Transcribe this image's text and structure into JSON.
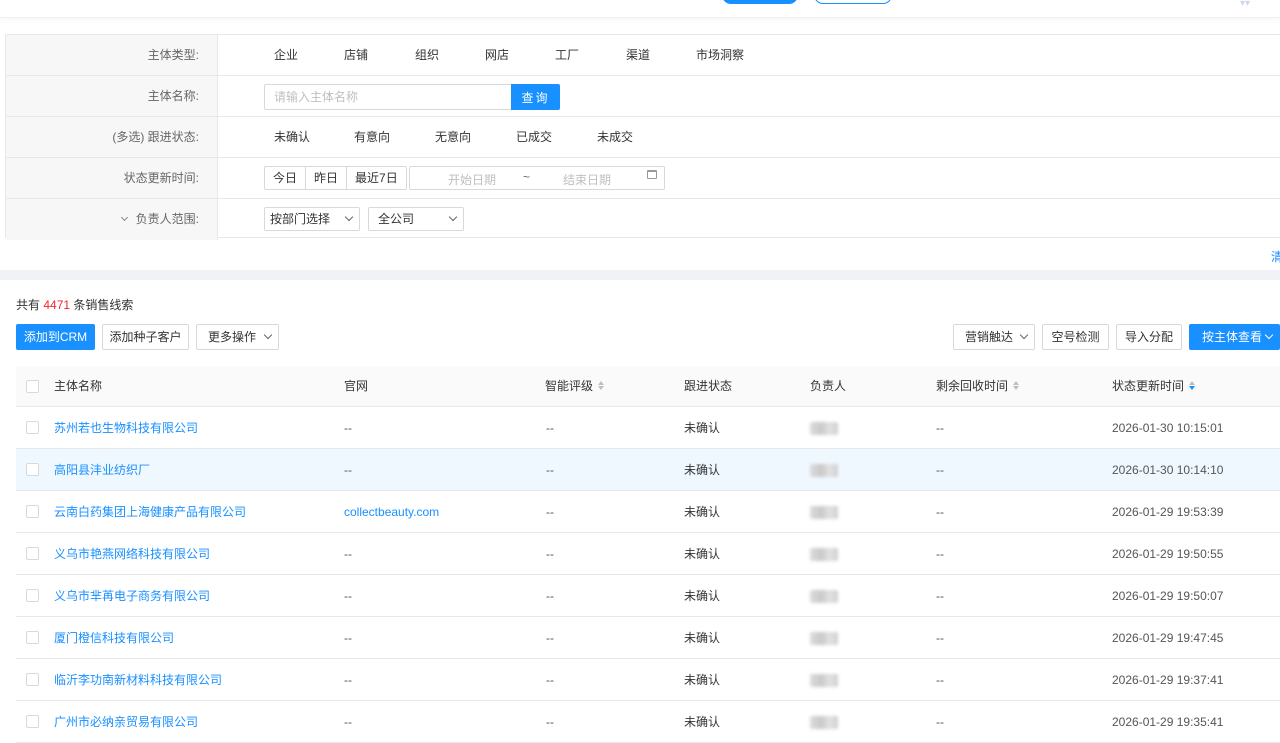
{
  "filters": {
    "subject_type": {
      "label": "主体类型:",
      "options": [
        "企业",
        "店铺",
        "组织",
        "网店",
        "工厂",
        "渠道",
        "市场洞察"
      ]
    },
    "subject_name": {
      "label": "主体名称:",
      "placeholder": "请输入主体名称",
      "button": "查询"
    },
    "follow_status": {
      "label": "(多选) 跟进状态:",
      "options": [
        "未确认",
        "有意向",
        "无意向",
        "已成交",
        "未成交"
      ]
    },
    "update_time": {
      "label": "状态更新时间:",
      "quick": [
        "今日",
        "昨日",
        "最近7日"
      ],
      "start_placeholder": "开始日期",
      "separator": "~",
      "end_placeholder": "结束日期"
    },
    "owner_scope": {
      "label": "负责人范围:",
      "select1": "按部门选择",
      "select2": "全公司"
    }
  },
  "right_clip": "清",
  "summary": {
    "prefix": "共有",
    "count": "4471",
    "suffix": "条销售线索"
  },
  "toolbar": {
    "add_crm": "添加到CRM",
    "add_seed": "添加种子客户",
    "more_ops": "更多操作",
    "marketing": "营销触达",
    "empty_check": "空号检测",
    "import_assign": "导入分配",
    "view_by_subject": "按主体查看"
  },
  "table": {
    "headers": {
      "name": "主体名称",
      "website": "官网",
      "rating": "智能评级",
      "status": "跟进状态",
      "owner": "负责人",
      "remaining": "剩余回收时间",
      "updated": "状态更新时间"
    },
    "rows": [
      {
        "name": "苏州若也生物科技有限公司",
        "website": "--",
        "rating": "--",
        "status": "未确认",
        "remaining": "--",
        "updated": "2026-01-30 10:15:01"
      },
      {
        "name": "高阳县沣业纺织厂",
        "website": "--",
        "rating": "--",
        "status": "未确认",
        "remaining": "--",
        "updated": "2026-01-30 10:14:10"
      },
      {
        "name": "云南白药集团上海健康产品有限公司",
        "website": "collectbeauty.com",
        "rating": "--",
        "status": "未确认",
        "remaining": "--",
        "updated": "2026-01-29 19:53:39"
      },
      {
        "name": "义乌市艳燕网络科技有限公司",
        "website": "--",
        "rating": "--",
        "status": "未确认",
        "remaining": "--",
        "updated": "2026-01-29 19:50:55"
      },
      {
        "name": "义乌市芈苒电子商务有限公司",
        "website": "--",
        "rating": "--",
        "status": "未确认",
        "remaining": "--",
        "updated": "2026-01-29 19:50:07"
      },
      {
        "name": "厦门橙信科技有限公司",
        "website": "--",
        "rating": "--",
        "status": "未确认",
        "remaining": "--",
        "updated": "2026-01-29 19:47:45"
      },
      {
        "name": "临沂李功南新材料科技有限公司",
        "website": "--",
        "rating": "--",
        "status": "未确认",
        "remaining": "--",
        "updated": "2026-01-29 19:37:41"
      },
      {
        "name": "广州市必纳亲贸易有限公司",
        "website": "--",
        "rating": "--",
        "status": "未确认",
        "remaining": "--",
        "updated": "2026-01-29 19:35:41"
      }
    ]
  }
}
